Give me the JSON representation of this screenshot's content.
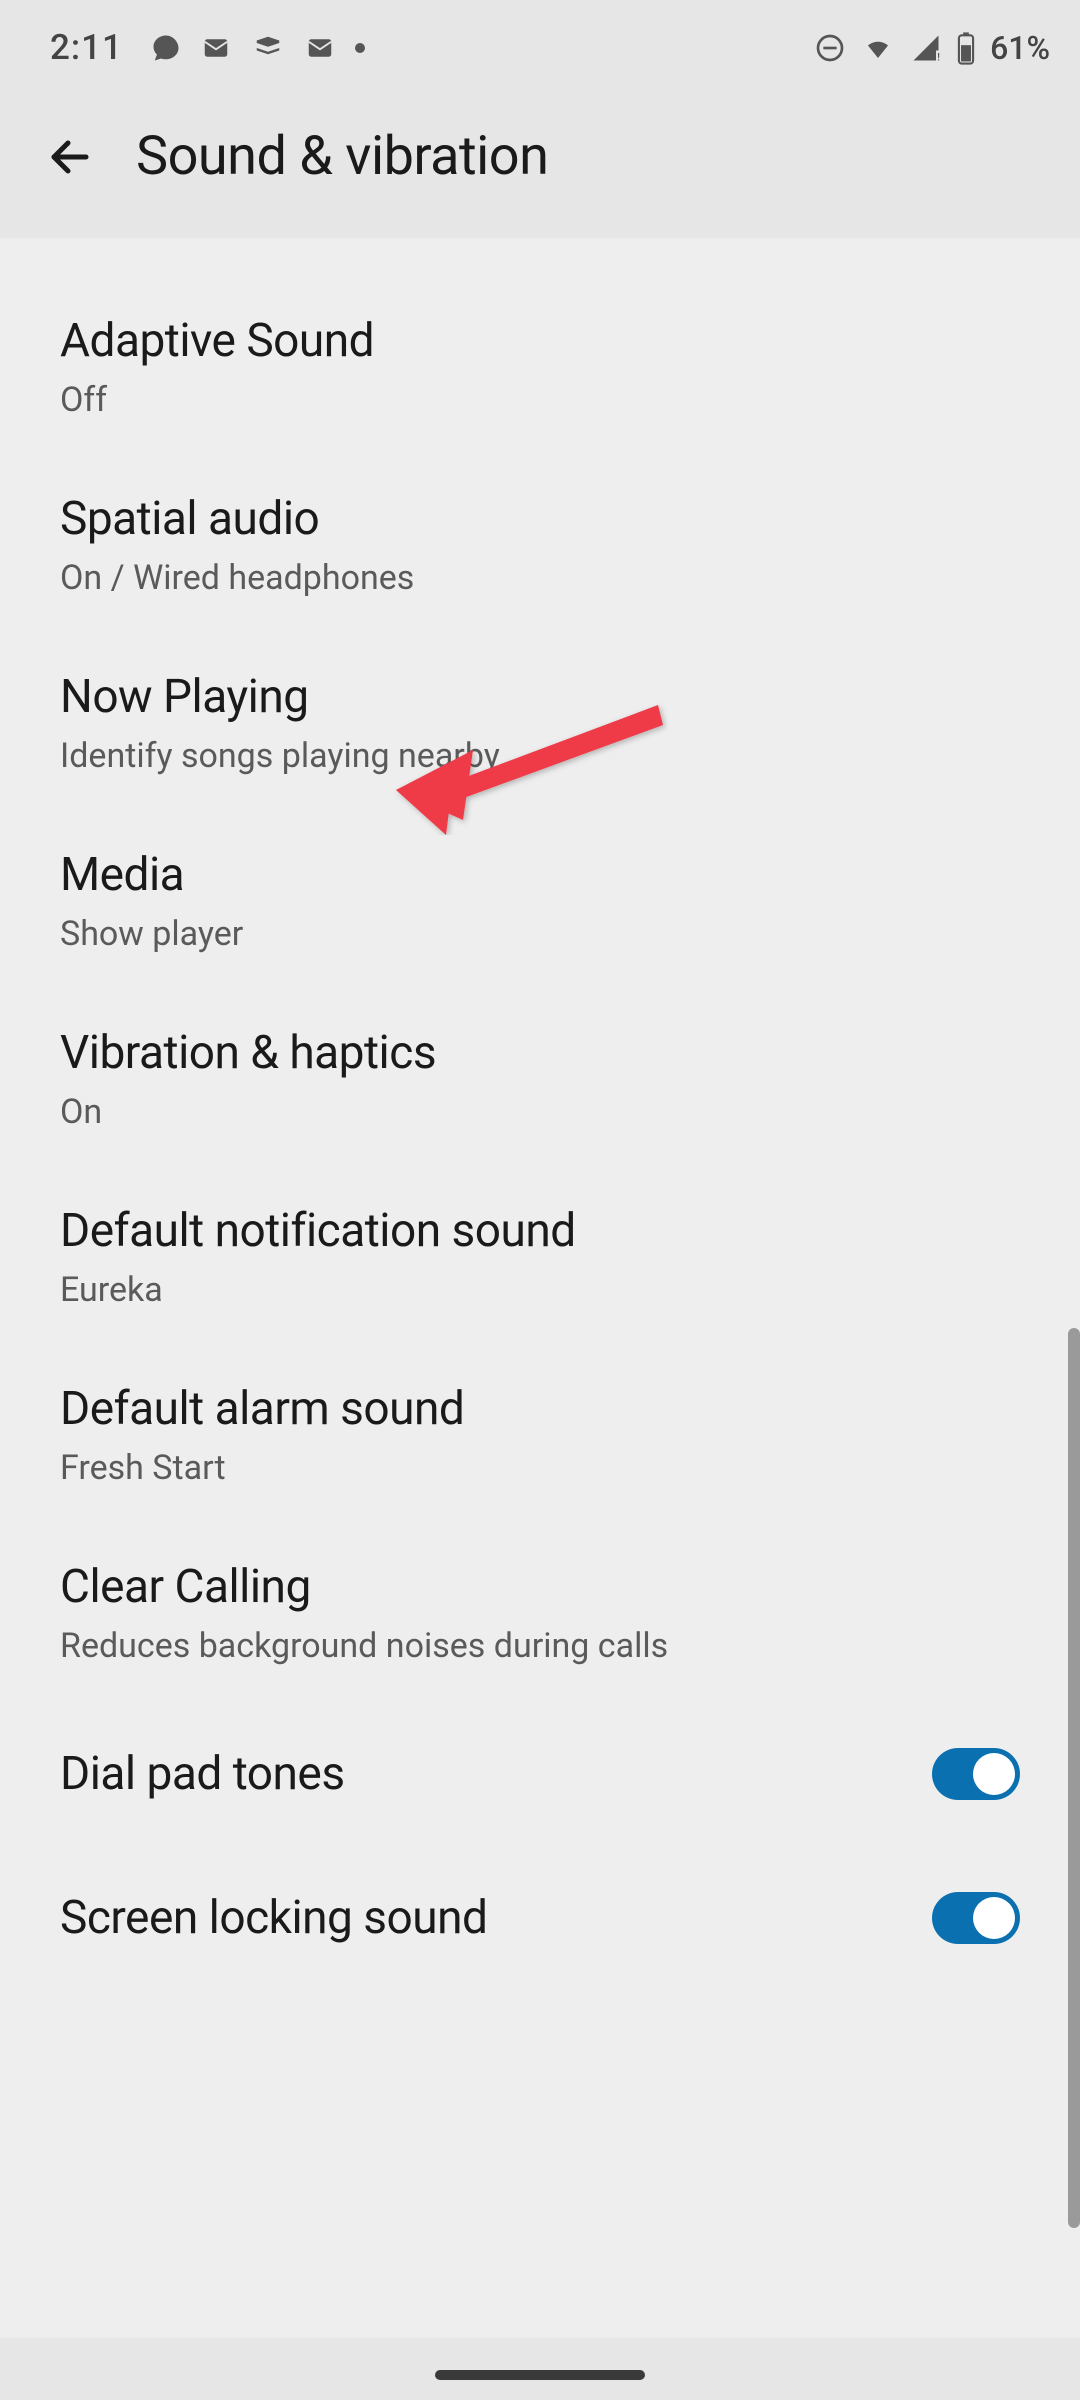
{
  "statusbar": {
    "time": "2:11",
    "battery": "61%"
  },
  "header": {
    "title": "Sound & vibration"
  },
  "settings": [
    {
      "title": "Adaptive Sound",
      "subtitle": "Off"
    },
    {
      "title": "Spatial audio",
      "subtitle": "On / Wired headphones"
    },
    {
      "title": "Now Playing",
      "subtitle": "Identify songs playing nearby"
    },
    {
      "title": "Media",
      "subtitle": "Show player"
    },
    {
      "title": "Vibration & haptics",
      "subtitle": "On"
    },
    {
      "title": "Default notification sound",
      "subtitle": "Eureka"
    },
    {
      "title": "Default alarm sound",
      "subtitle": "Fresh Start"
    },
    {
      "title": "Clear Calling",
      "subtitle": "Reduces background noises during calls"
    }
  ],
  "toggles": [
    {
      "title": "Dial pad tones",
      "enabled": true
    },
    {
      "title": "Screen locking sound",
      "enabled": true
    }
  ],
  "annotation": {
    "target_setting": "Now Playing"
  }
}
